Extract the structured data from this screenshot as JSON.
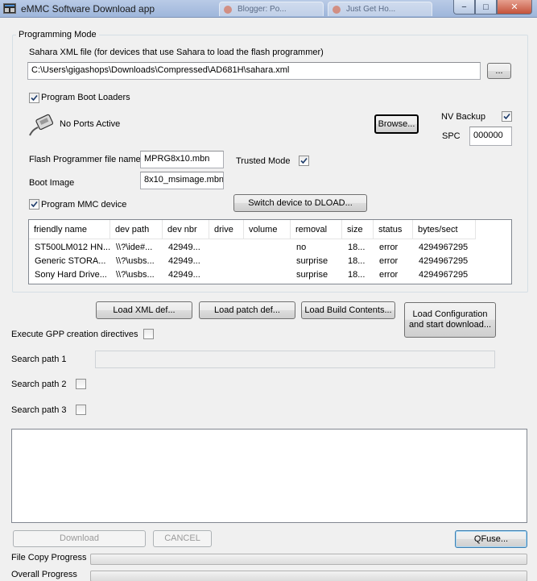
{
  "window": {
    "title": "eMMC Software Download app"
  },
  "background_tabs": [
    "Blogger: Po...",
    "Just Get Ho..."
  ],
  "titlebar_buttons": {
    "minimize": "−",
    "maximize": "□",
    "close": "✕"
  },
  "programming_mode": {
    "group_title": "Programming Mode",
    "sahara_label": "Sahara XML file (for devices that use Sahara to load the flash programmer)",
    "sahara_path": "C:\\Users\\gigashops\\Downloads\\Compressed\\AD681H\\sahara.xml",
    "browse_sahara_label": "...",
    "program_boot_loaders": {
      "label": "Program Boot Loaders",
      "checked": true
    },
    "port_status": "No Ports Active",
    "browse_label": "Browse...",
    "nv_backup": {
      "label": "NV Backup",
      "checked": true
    },
    "spc_label": "SPC",
    "spc_value": "000000",
    "flash_programmer_label": "Flash Programmer file name",
    "flash_programmer_value": "MPRG8x10.mbn",
    "trusted_mode": {
      "label": "Trusted Mode",
      "checked": true
    },
    "boot_image_label": "Boot Image",
    "boot_image_value": "8x10_msimage.mbn",
    "program_mmc": {
      "label": "Program MMC device",
      "checked": true
    },
    "switch_dload_label": "Switch device to DLOAD..."
  },
  "device_table": {
    "columns": [
      "friendly name",
      "dev path",
      "dev nbr",
      "drive",
      "volume",
      "removal",
      "size",
      "status",
      "bytes/sect"
    ],
    "rows": [
      [
        "ST500LM012 HN...",
        "\\\\?\\ide#...",
        "42949...",
        "",
        "",
        "no",
        "18...",
        "error",
        "4294967295"
      ],
      [
        "Generic STORA...",
        "\\\\?\\usbs...",
        "42949...",
        "",
        "",
        "surprise",
        "18...",
        "error",
        "4294967295"
      ],
      [
        "Sony Hard Drive...",
        "\\\\?\\usbs...",
        "42949...",
        "",
        "",
        "surprise",
        "18...",
        "error",
        "4294967295"
      ]
    ]
  },
  "actions": {
    "load_xml": "Load XML def...",
    "load_patch": "Load patch def...",
    "load_build": "Load Build Contents...",
    "load_config_line1": "Load Configuration",
    "load_config_line2": "and start download..."
  },
  "gpp": {
    "label": "Execute GPP creation directives",
    "checked": false
  },
  "search_paths": [
    {
      "label": "Search path 1",
      "value": ""
    },
    {
      "label": "Search path 2",
      "checked": false
    },
    {
      "label": "Search path 3",
      "checked": false
    }
  ],
  "bottom": {
    "download": "Download",
    "cancel": "CANCEL",
    "qfuse": "QFuse...",
    "file_copy_label": "File Copy Progress",
    "file_copy_progress": 0,
    "overall_label": "Overall Progress",
    "overall_progress": 0
  }
}
